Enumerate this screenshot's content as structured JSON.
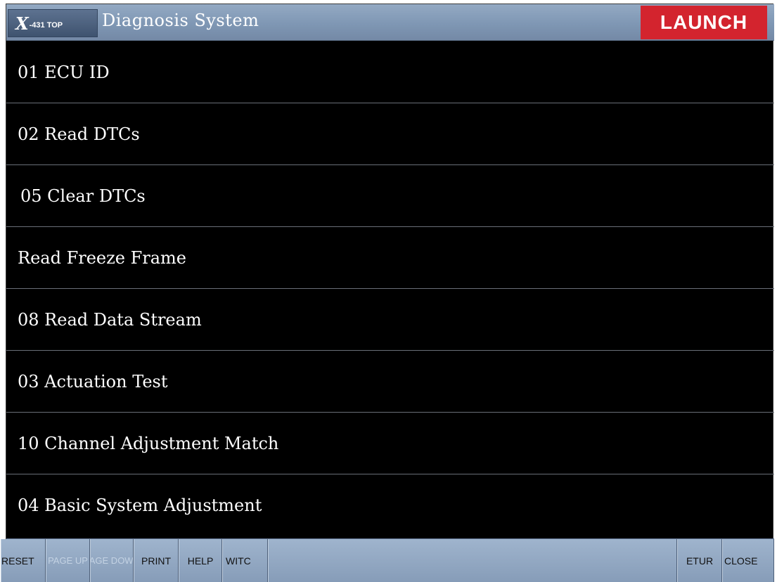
{
  "header": {
    "logo_mark": "X",
    "logo_text": "-431 TOP",
    "title": "Diagnosis System",
    "brand": "LAUNCH"
  },
  "menu": {
    "items": [
      {
        "label": "01 ECU ID"
      },
      {
        "label": "02 Read DTCs"
      },
      {
        "label": "05 Clear DTCs"
      },
      {
        "label": "Read Freeze Frame"
      },
      {
        "label": "08 Read Data Stream"
      },
      {
        "label": "03 Actuation Test"
      },
      {
        "label": "10 Channel Adjustment Match"
      },
      {
        "label": "04 Basic System Adjustment"
      }
    ]
  },
  "toolbar": {
    "reset": "RESET",
    "page_up": "PAGE UP",
    "page_down": "PAGE DOWN",
    "print": "PRINT",
    "help": "HELP",
    "switch": "WITC",
    "return": "ETUR",
    "close": "CLOSE"
  },
  "colors": {
    "title_bar": "#7f97b4",
    "brand_red": "#d3242e",
    "background": "#000000",
    "text": "#ffffff"
  }
}
